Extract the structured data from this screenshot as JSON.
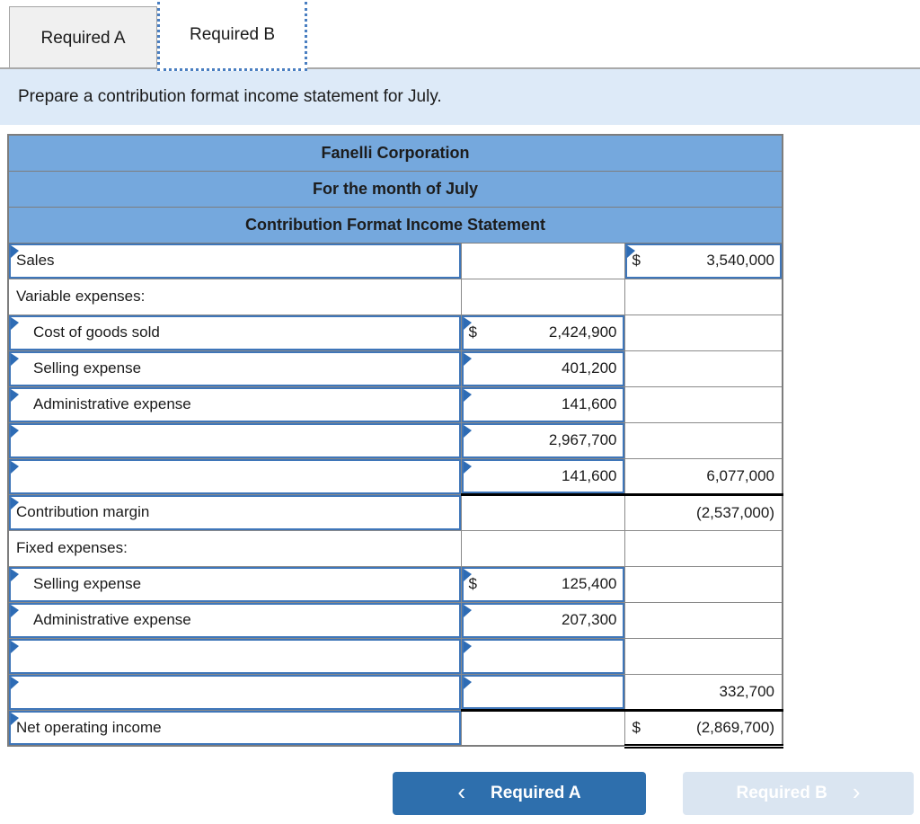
{
  "tabs": {
    "a": "Required A",
    "b": "Required B"
  },
  "instruction": "Prepare a contribution format income statement for July.",
  "statement": {
    "header": [
      "Fanelli Corporation",
      "For the month of July",
      "Contribution Format Income Statement"
    ],
    "rows": [
      {
        "label": "Sales",
        "mid_d": "",
        "mid_v": "",
        "right_d": "$",
        "right_v": "3,540,000"
      },
      {
        "label": "Variable expenses:",
        "mid_d": "",
        "mid_v": "",
        "right_d": "",
        "right_v": ""
      },
      {
        "label": "Cost of goods sold",
        "mid_d": "$",
        "mid_v": "2,424,900",
        "right_d": "",
        "right_v": ""
      },
      {
        "label": "Selling expense",
        "mid_d": "",
        "mid_v": "401,200",
        "right_d": "",
        "right_v": ""
      },
      {
        "label": "Administrative expense",
        "mid_d": "",
        "mid_v": "141,600",
        "right_d": "",
        "right_v": ""
      },
      {
        "label": "",
        "mid_d": "",
        "mid_v": "2,967,700",
        "right_d": "",
        "right_v": ""
      },
      {
        "label": "",
        "mid_d": "",
        "mid_v": "141,600",
        "right_d": "",
        "right_v": "6,077,000"
      },
      {
        "label": "Contribution margin",
        "mid_d": "",
        "mid_v": "",
        "right_d": "",
        "right_v": "(2,537,000)"
      },
      {
        "label": "Fixed expenses:",
        "mid_d": "",
        "mid_v": "",
        "right_d": "",
        "right_v": ""
      },
      {
        "label": "Selling expense",
        "mid_d": "$",
        "mid_v": "125,400",
        "right_d": "",
        "right_v": ""
      },
      {
        "label": "Administrative expense",
        "mid_d": "",
        "mid_v": "207,300",
        "right_d": "",
        "right_v": ""
      },
      {
        "label": "",
        "mid_d": "",
        "mid_v": "",
        "right_d": "",
        "right_v": ""
      },
      {
        "label": "",
        "mid_d": "",
        "mid_v": "",
        "right_d": "",
        "right_v": "332,700"
      },
      {
        "label": "Net operating income",
        "mid_d": "",
        "mid_v": "",
        "right_d": "$",
        "right_v": "(2,869,700)"
      }
    ]
  },
  "footer": {
    "prev_chevron": "‹",
    "prev_label": "Required A",
    "next_label": "Required B",
    "next_chevron": "›"
  },
  "colors": {
    "header_blue": "#75a8dd",
    "input_border_blue": "#3f76b9",
    "marker_blue": "#2e6cb5",
    "instruction_bg": "#ddeaf8",
    "tab_dotted_blue": "#4a7fc1",
    "button_active_blue": "#2e6fad",
    "button_disabled_blue": "#dae5f1"
  }
}
